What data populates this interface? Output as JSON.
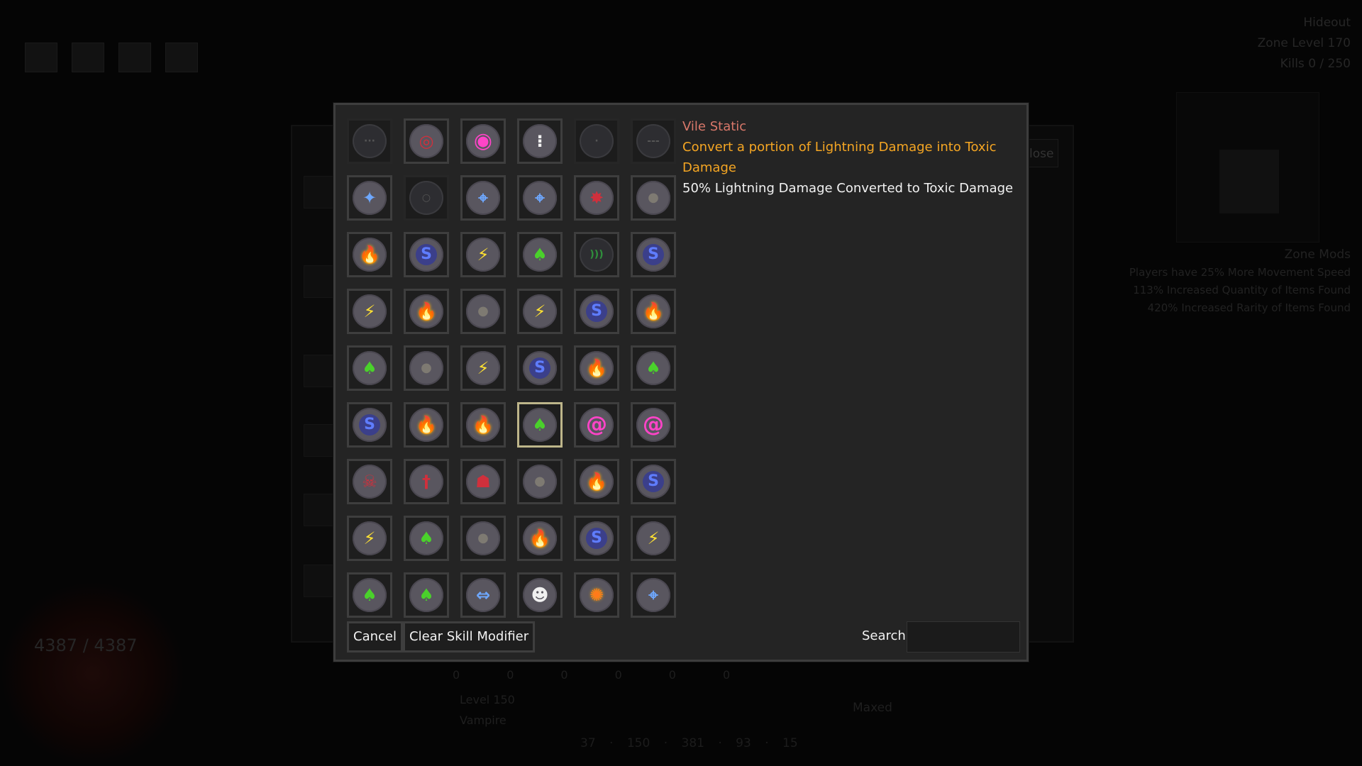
{
  "background": {
    "zone": {
      "title": "Hideout",
      "level": "Zone Level 170",
      "kills": "Kills 0 / 250"
    },
    "zone_mods": {
      "title": "Zone Mods",
      "lines": [
        "Players have 25% More Movement Speed",
        "113% Increased Quantity of Items Found",
        "420% Increased Rarity of Items Found"
      ]
    },
    "close_label": "lose",
    "hp_text": "4387 / 4387",
    "bottom_numbers": [
      "0",
      "0",
      "0",
      "0",
      "0",
      "0"
    ],
    "level_line1": "Level 150",
    "level_line2": "Vampire",
    "maxed_label": "Maxed",
    "bottom_stats": "37 · 150 · 381 · 93 · 15"
  },
  "tooltip": {
    "name": "Vile Static",
    "description": "Convert a portion of Lightning Damage into Toxic Damage",
    "stat": "50% Lightning Damage Converted to Toxic Damage"
  },
  "buttons": {
    "cancel": "Cancel",
    "clear": "Clear Skill Modifier"
  },
  "search": {
    "label": "Search",
    "value": ""
  },
  "grid": [
    [
      {
        "icon": "dark-orb-icon",
        "glyph": "···"
      },
      {
        "icon": "red-ring-orb-icon",
        "glyph": "◎"
      },
      {
        "icon": "pink-ring-orb-icon",
        "glyph": "◉"
      },
      {
        "icon": "skull-orb-icon",
        "glyph": "⁝"
      },
      {
        "icon": "dark-orb-icon",
        "glyph": "·"
      },
      {
        "icon": "dark-orb-icon",
        "glyph": "---"
      }
    ],
    [
      {
        "icon": "blue-cross-icon",
        "glyph": "✦"
      },
      {
        "icon": "dark-orb-icon",
        "glyph": "○"
      },
      {
        "icon": "blue-crosshair-icon",
        "glyph": "⌖"
      },
      {
        "icon": "blue-crosshair-icon",
        "glyph": "⌖"
      },
      {
        "icon": "red-beetle-icon",
        "glyph": "✸"
      },
      {
        "icon": "physical-orb-icon",
        "glyph": "●"
      }
    ],
    [
      {
        "icon": "fire-orb-icon",
        "glyph": "🔥"
      },
      {
        "icon": "frost-orb-icon",
        "glyph": "S"
      },
      {
        "icon": "lightning-orb-icon",
        "glyph": "⚡"
      },
      {
        "icon": "toxic-orb-icon",
        "glyph": "♠"
      },
      {
        "icon": "sound-wave-icon",
        "glyph": ")))"
      },
      {
        "icon": "frost-orb-icon",
        "glyph": "S"
      }
    ],
    [
      {
        "icon": "lightning-orb-icon",
        "glyph": "⚡"
      },
      {
        "icon": "fire-orb-icon",
        "glyph": "🔥"
      },
      {
        "icon": "physical-orb-icon",
        "glyph": "●"
      },
      {
        "icon": "lightning-orb-icon",
        "glyph": "⚡"
      },
      {
        "icon": "frost-orb-icon",
        "glyph": "S"
      },
      {
        "icon": "fire-orb-icon",
        "glyph": "🔥"
      }
    ],
    [
      {
        "icon": "toxic-orb-icon",
        "glyph": "♠"
      },
      {
        "icon": "physical-orb-icon",
        "glyph": "●"
      },
      {
        "icon": "lightning-orb-icon",
        "glyph": "⚡"
      },
      {
        "icon": "frost-orb-icon",
        "glyph": "S"
      },
      {
        "icon": "fire-orb-icon",
        "glyph": "🔥"
      },
      {
        "icon": "toxic-orb-icon",
        "glyph": "♠"
      }
    ],
    [
      {
        "icon": "frost-orb-icon",
        "glyph": "S"
      },
      {
        "icon": "fire-orb-icon",
        "glyph": "🔥"
      },
      {
        "icon": "fire-orb-icon",
        "glyph": "🔥"
      },
      {
        "icon": "toxic-orb-icon",
        "glyph": "♠",
        "selected": true
      },
      {
        "icon": "chaos-spiral-icon",
        "glyph": "@"
      },
      {
        "icon": "chaos-spiral-icon",
        "glyph": "@"
      }
    ],
    [
      {
        "icon": "blood-skull-icon",
        "glyph": "☠"
      },
      {
        "icon": "sword-orb-icon",
        "glyph": "†"
      },
      {
        "icon": "demon-face-icon",
        "glyph": "☗"
      },
      {
        "icon": "physical-orb-icon",
        "glyph": "●"
      },
      {
        "icon": "fire-orb-icon",
        "glyph": "🔥"
      },
      {
        "icon": "frost-orb-icon",
        "glyph": "S"
      }
    ],
    [
      {
        "icon": "lightning-orb-icon",
        "glyph": "⚡"
      },
      {
        "icon": "toxic-orb-icon",
        "glyph": "♠"
      },
      {
        "icon": "physical-orb-icon",
        "glyph": "●"
      },
      {
        "icon": "fire-orb-icon",
        "glyph": "🔥"
      },
      {
        "icon": "frost-orb-icon",
        "glyph": "S"
      },
      {
        "icon": "lightning-orb-icon",
        "glyph": "⚡"
      }
    ],
    [
      {
        "icon": "toxic-orb-icon",
        "glyph": "♠"
      },
      {
        "icon": "toxic-orb-icon",
        "glyph": "♠"
      },
      {
        "icon": "blue-arrow-wave-icon",
        "glyph": "⇔"
      },
      {
        "icon": "skull-wave-icon",
        "glyph": "☻"
      },
      {
        "icon": "multicolor-wave-icon",
        "glyph": "✺"
      },
      {
        "icon": "blue-crosshair-icon",
        "glyph": "⌖"
      }
    ]
  ],
  "colors": {
    "selected_border": "#bdb58a",
    "tooltip_name": "#d9786a",
    "tooltip_desc": "#f5a623"
  }
}
